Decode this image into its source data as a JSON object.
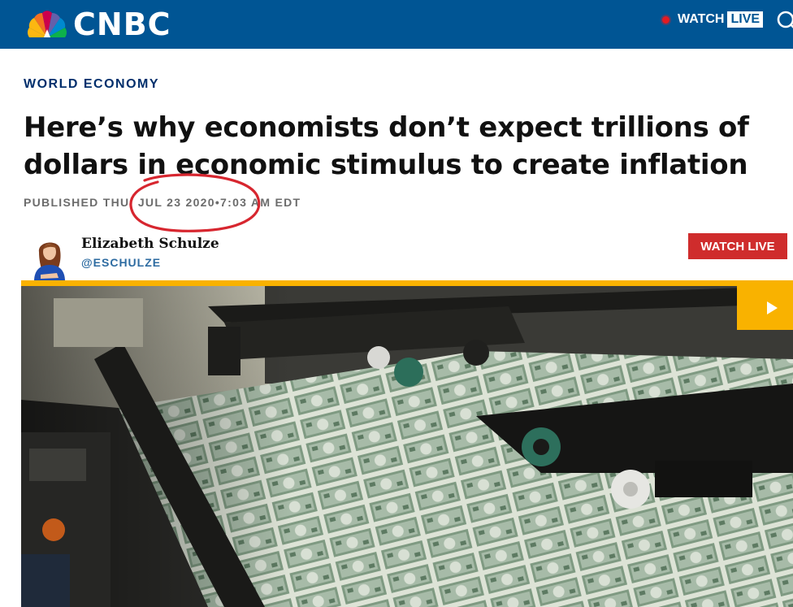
{
  "header": {
    "logo_text": "CNBC",
    "watch_label": "WATCH",
    "live_label": "LIVE",
    "brand_color": "#005594",
    "icons": [
      "nbc-peacock-icon",
      "live-dot-icon",
      "search-icon"
    ]
  },
  "article": {
    "section": "WORLD ECONOMY",
    "headline_line1": "Here’s why economists don’t expect trillions of",
    "headline_line2": "dollars in economic stimulus to create inflation",
    "published": "PUBLISHED THU, JUL 23 2020•7:03 AM EDT"
  },
  "author": {
    "name": "Elizabeth Schulze",
    "handle": "@ESCHULZE"
  },
  "watch_live_button": "WATCH LIVE",
  "media": {
    "play_icon": "play-icon",
    "accent_color": "#f9b200"
  }
}
